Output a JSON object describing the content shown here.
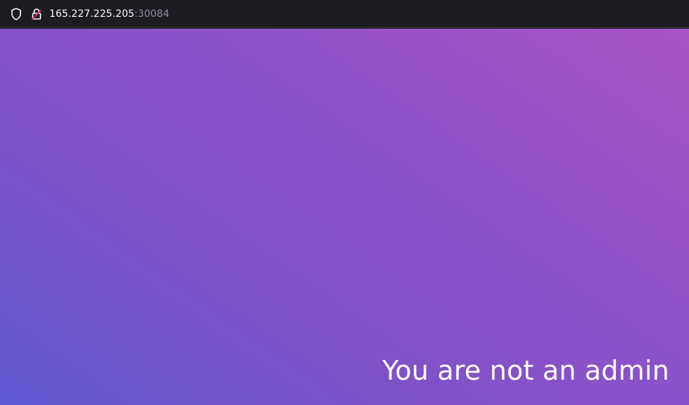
{
  "browser": {
    "address_host": "165.227.225.205",
    "address_port": ":30084",
    "icons": {
      "site_info": "shield-icon",
      "connection": "insecure-lock-icon"
    }
  },
  "page": {
    "message": "You are not an admin",
    "colors": {
      "gradient_start": "#5f58d2",
      "gradient_end": "#a854c4",
      "text": "#ffffff"
    }
  }
}
